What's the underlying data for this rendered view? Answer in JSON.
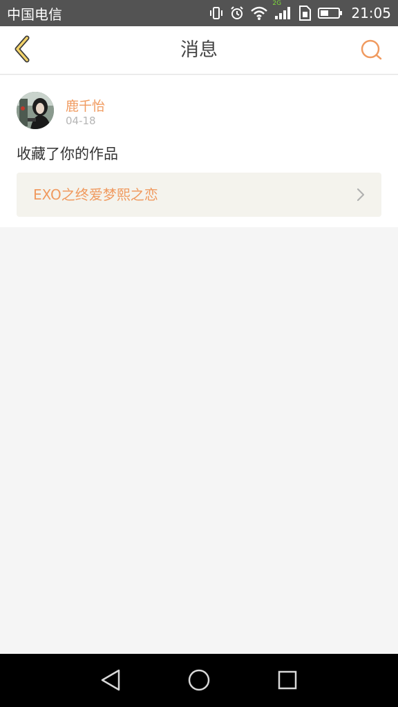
{
  "status_bar": {
    "carrier": "中国电信",
    "network_label": "2G",
    "time": "21:05"
  },
  "nav": {
    "title": "消息",
    "back_icon": "chevron-left-icon",
    "search_icon": "search-icon",
    "accent_color": "#f09a5f"
  },
  "message": {
    "sender": "鹿千怡",
    "date": "04-18",
    "text": "收藏了你的作品",
    "work_title": "EXO之终爱梦熙之恋"
  },
  "system_nav": {
    "back_icon": "triangle-back-icon",
    "home_icon": "circle-home-icon",
    "recents_icon": "square-recents-icon"
  }
}
